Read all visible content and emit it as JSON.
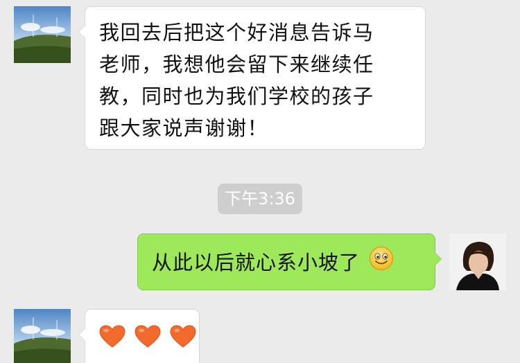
{
  "messages": [
    {
      "direction": "incoming",
      "lines": [
        "我回去后把这个好消息告诉马",
        "老师，我想他会留下来继续任",
        "教，同时也为我们学校的孩子",
        "跟大家说声谢谢！"
      ]
    },
    {
      "type": "timestamp",
      "text": "下午3:36"
    },
    {
      "direction": "outgoing",
      "text": "从此以后就心系小坡了",
      "emoji": "smile-emoji"
    },
    {
      "direction": "incoming",
      "hearts": [
        "heart-emoji",
        "heart-emoji",
        "heart-emoji"
      ]
    }
  ],
  "colors": {
    "background": "#ebebeb",
    "incoming_bubble": "#ffffff",
    "outgoing_bubble": "#9ee95a",
    "timestamp_bg": "#cecece",
    "heart": "#f26b2c"
  }
}
